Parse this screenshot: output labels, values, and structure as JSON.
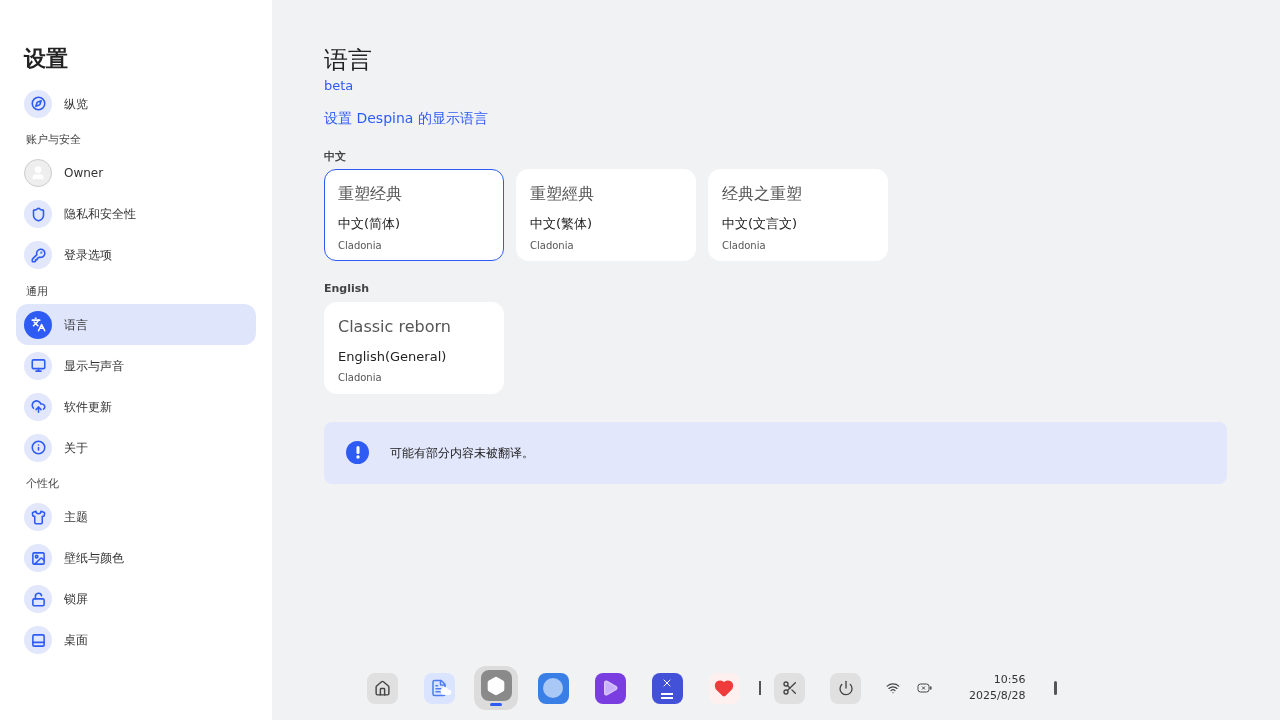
{
  "sidebar": {
    "title": "设置",
    "sections": [
      {
        "items": [
          {
            "label": "纵览",
            "kind": "icon",
            "selected": false
          }
        ]
      },
      {
        "header": "账户与安全",
        "items": [
          {
            "label": "Owner",
            "kind": "avatar",
            "selected": false
          },
          {
            "label": "隐私和安全性",
            "kind": "icon",
            "selected": false
          },
          {
            "label": "登录选项",
            "kind": "icon",
            "selected": false
          }
        ]
      },
      {
        "header": "通用",
        "items": [
          {
            "label": "语言",
            "kind": "icon",
            "selected": true
          },
          {
            "label": "显示与声音",
            "kind": "icon",
            "selected": false
          },
          {
            "label": "软件更新",
            "kind": "icon",
            "selected": false
          },
          {
            "label": "关于",
            "kind": "icon",
            "selected": false
          }
        ]
      },
      {
        "header": "个性化",
        "items": [
          {
            "label": "主题",
            "kind": "icon",
            "selected": false
          },
          {
            "label": "壁纸与颜色",
            "kind": "icon",
            "selected": false
          },
          {
            "label": "锁屏",
            "kind": "icon",
            "selected": false
          },
          {
            "label": "桌面",
            "kind": "icon",
            "selected": false
          }
        ]
      }
    ]
  },
  "page": {
    "title": "语言",
    "badge": "beta",
    "subtitle": "设置 Despina 的显示语言",
    "groups": [
      {
        "heading": "中文",
        "cards": [
          {
            "sample": "重塑经典",
            "name": "中文(简体)",
            "author": "Cladonia",
            "selected": true
          },
          {
            "sample": "重塑經典",
            "name": "中文(繁体)",
            "author": "Cladonia",
            "selected": false
          },
          {
            "sample": "经典之重塑",
            "name": "中文(文言文)",
            "author": "Cladonia",
            "selected": false
          }
        ]
      },
      {
        "heading": "English",
        "cards": [
          {
            "sample": "Classic reborn",
            "name": "English(General)",
            "author": "Cladonia",
            "selected": false
          }
        ]
      }
    ],
    "notice": "可能有部分内容未被翻译。"
  },
  "taskbar": {
    "apps": [
      {
        "selected": false
      },
      {
        "selected": false
      },
      {
        "selected": true
      },
      {
        "selected": false
      },
      {
        "selected": false
      },
      {
        "selected": false
      },
      {
        "selected": false
      }
    ],
    "time": "10:56",
    "date": "2025/8/28"
  }
}
